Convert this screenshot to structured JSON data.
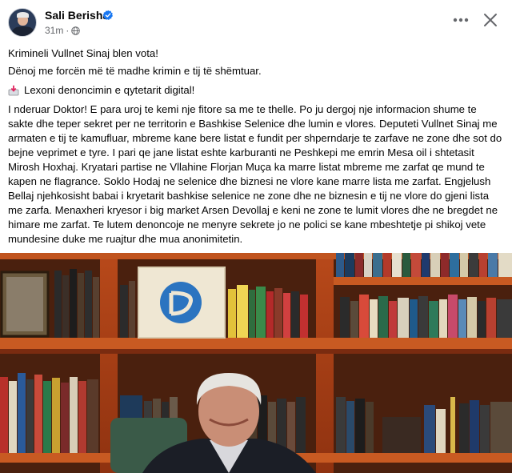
{
  "post": {
    "author": "Sali Berisha",
    "time": "31m",
    "more_icon": "more-dots-icon",
    "close_icon": "close-icon",
    "privacy_icon": "globe-icon",
    "verified_color": "#1877f2",
    "line1": "Krimineli Vullnet Sinaj blen vota!",
    "line2": "Dënoj me forcën më të madhe krimin e tij të shëmtuar.",
    "line3": "Lexoni denoncimin e qytetarit digital!",
    "line3_icon": "inbox-tray-icon",
    "body": "I nderuar Doktor! E para uroj te kemi nje fitore sa me te thelle. Po ju dergoj nje informacion shume te sakte dhe teper sekret per ne territorin e Bashkise Selenice dhe lumin e vlores. Deputeti Vullnet Sinaj me armaten e tij te kamufluar, mbreme kane bere listat e fundit per shperndarje te zarfave ne zone dhe sot do bejne veprimet e tyre. I pari qe jane listat eshte karburanti ne Peshkepi me emrin Mesa oil i shtetasit Mirosh Hoxhaj. Kryatari partise ne Vllahine Florjan Muça ka marre listat mbreme me zarfat qe mund te kapen ne flagrance. Soklo Hodaj ne selenice dhe biznesi ne vlore kane marre lista me zarfat. Engjelush Bellaj njehkosisht babai i kryetarit bashkise selenice ne zone dhe ne biznesin e tij ne vlore do gjeni lista me zarfa. Menaxheri kryesor i big market Arsen Devollaj e keni ne zone te lumit vlores dhe ne bregdet ne himare me zarfat. Te lutem denoncoje ne menyre sekrete jo ne polici se kane mbeshtetje pi shikoj vete mundesine duke me ruajtur dhe mua anonimitetin."
  },
  "photo": {
    "description_icon": "post-photo"
  }
}
